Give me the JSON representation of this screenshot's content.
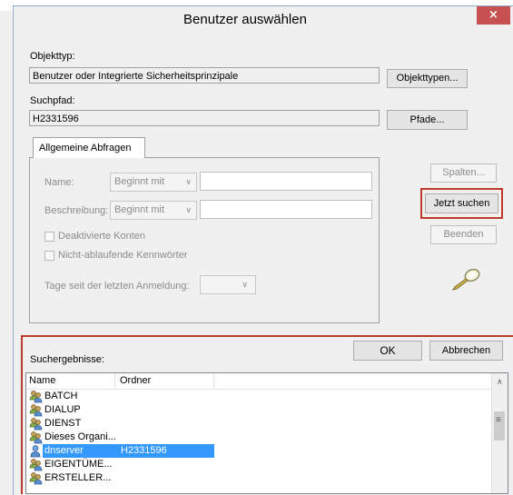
{
  "window": {
    "title": "Benutzer auswählen",
    "close_glyph": "×"
  },
  "object_type": {
    "label": "Objekttyp:",
    "value": "Benutzer oder Integrierte Sicherheitsprinzipale",
    "button": "Objekttypen..."
  },
  "search_path": {
    "label": "Suchpfad:",
    "value": "H2331596",
    "button": "Pfade..."
  },
  "query": {
    "tab": "Allgemeine Abfragen",
    "name_label": "Name:",
    "name_mode": "Beginnt mit",
    "desc_label": "Beschreibung:",
    "desc_mode": "Beginnt mit",
    "disabled_accounts": "Deaktivierte Konten",
    "non_expiring_pw": "Nicht-ablaufende Kennwörter",
    "days_label": "Tage seit der letzten Anmeldung:"
  },
  "side_buttons": {
    "columns": "Spalten...",
    "search_now": "Jetzt suchen",
    "stop": "Beenden"
  },
  "results": {
    "label": "Suchergebnisse:",
    "ok": "OK",
    "cancel": "Abbrechen",
    "columns": [
      "Name",
      "Ordner"
    ],
    "rows": [
      {
        "name": "BATCH",
        "folder": "",
        "kind": "group"
      },
      {
        "name": "DIALUP",
        "folder": "",
        "kind": "group"
      },
      {
        "name": "DIENST",
        "folder": "",
        "kind": "group"
      },
      {
        "name": "Dieses Organi...",
        "folder": "",
        "kind": "group"
      },
      {
        "name": "dnserver",
        "folder": "H2331596",
        "kind": "user",
        "selected": true
      },
      {
        "name": "EIGENTÜME...",
        "folder": "",
        "kind": "group"
      },
      {
        "name": "ERSTELLER...",
        "folder": "",
        "kind": "group"
      }
    ]
  },
  "colors": {
    "highlight": "#c0392b",
    "selection": "#3399ff",
    "close": "#c75050"
  }
}
